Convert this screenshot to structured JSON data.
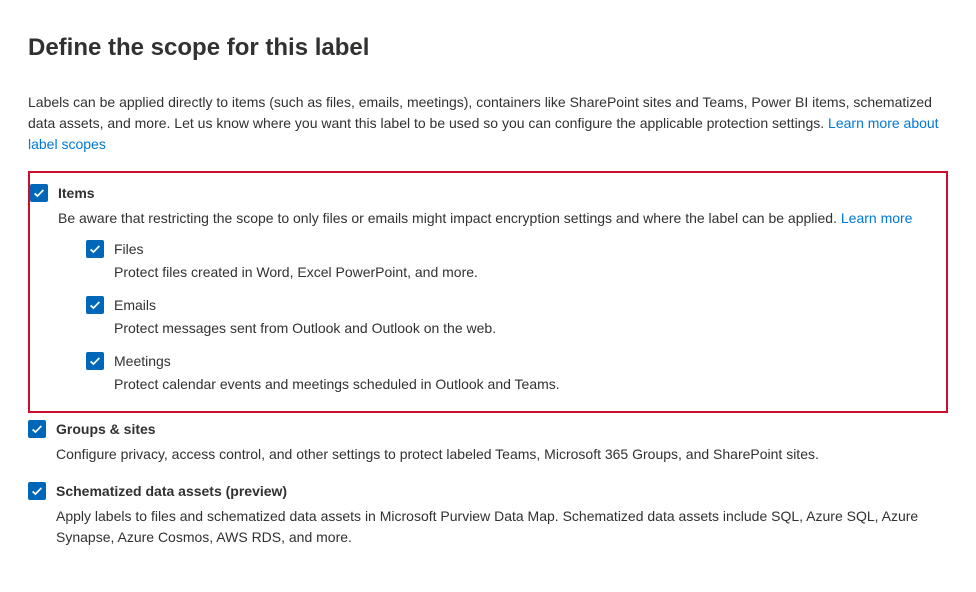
{
  "heading": "Define the scope for this label",
  "intro_text": "Labels can be applied directly to items (such as files, emails, meetings), containers like SharePoint sites and Teams, Power BI items, schematized data assets, and more. Let us know where you want this label to be used so you can configure the applicable protection settings. ",
  "intro_link": "Learn more about label scopes",
  "scopes": {
    "items": {
      "label": "Items",
      "desc": "Be aware that restricting the scope to only files or emails might impact encryption settings and where the label can be applied. ",
      "learn_more": "Learn more",
      "subs": {
        "files": {
          "label": "Files",
          "desc": "Protect files created in Word, Excel PowerPoint, and more."
        },
        "emails": {
          "label": "Emails",
          "desc": "Protect messages sent from Outlook and Outlook on the web."
        },
        "meetings": {
          "label": "Meetings",
          "desc": "Protect calendar events and meetings scheduled in Outlook and Teams."
        }
      }
    },
    "groups": {
      "label": "Groups & sites",
      "desc": "Configure privacy, access control, and other settings to protect labeled Teams, Microsoft 365 Groups, and SharePoint sites."
    },
    "schematized": {
      "label": "Schematized data assets (preview)",
      "desc": "Apply labels to files and schematized data assets in Microsoft Purview Data Map. Schematized data assets include SQL, Azure SQL, Azure Synapse, Azure Cosmos, AWS RDS, and more."
    }
  }
}
